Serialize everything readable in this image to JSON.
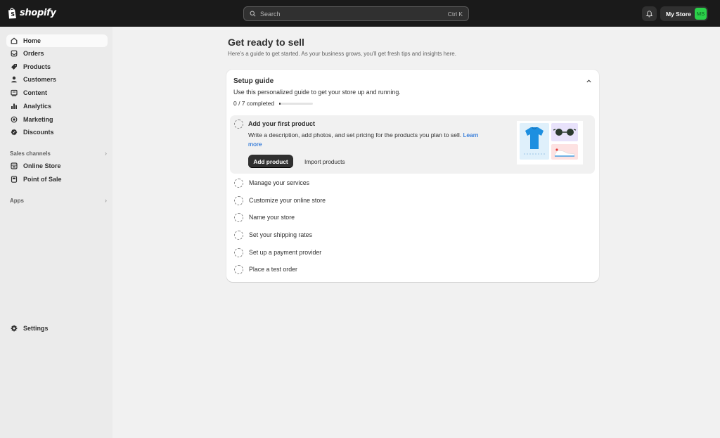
{
  "topbar": {
    "brand": "shopify",
    "search_placeholder": "Search",
    "search_shortcut": "Ctrl K",
    "store_name": "My Store",
    "avatar_initials": "MS"
  },
  "sidebar": {
    "items": [
      {
        "label": "Home",
        "icon": "home-icon",
        "active": true
      },
      {
        "label": "Orders",
        "icon": "orders-icon"
      },
      {
        "label": "Products",
        "icon": "tag-icon"
      },
      {
        "label": "Customers",
        "icon": "person-icon"
      },
      {
        "label": "Content",
        "icon": "content-icon"
      },
      {
        "label": "Analytics",
        "icon": "bar-chart-icon"
      },
      {
        "label": "Marketing",
        "icon": "target-icon"
      },
      {
        "label": "Discounts",
        "icon": "discount-icon"
      }
    ],
    "sales_channels_label": "Sales channels",
    "channels": [
      {
        "label": "Online Store",
        "icon": "store-icon"
      },
      {
        "label": "Point of Sale",
        "icon": "pos-icon"
      }
    ],
    "apps_label": "Apps",
    "settings_label": "Settings"
  },
  "main": {
    "title": "Get ready to sell",
    "subtitle": "Here’s a guide to get started. As your business grows, you’ll get fresh tips and insights here."
  },
  "setup_guide": {
    "title": "Setup guide",
    "description": "Use this personalized guide to get your store up and running.",
    "progress_text": "0 / 7 completed",
    "progress_fraction": 0.0,
    "active_task": {
      "title": "Add your first product",
      "description": "Write a description, add photos, and set pricing for the products you plan to sell.",
      "link": "Learn more",
      "primary_button": "Add product",
      "secondary_button": "Import products"
    },
    "tasks": [
      "Manage your services",
      "Customize your online store",
      "Name your store",
      "Set your shipping rates",
      "Set up a payment provider",
      "Place a test order"
    ]
  },
  "colors": {
    "topbar": "#1a1a1a",
    "sidebar": "#ebebeb",
    "page": "#f1f1f1",
    "avatar": "#2bd14a",
    "link": "#005bd3"
  }
}
